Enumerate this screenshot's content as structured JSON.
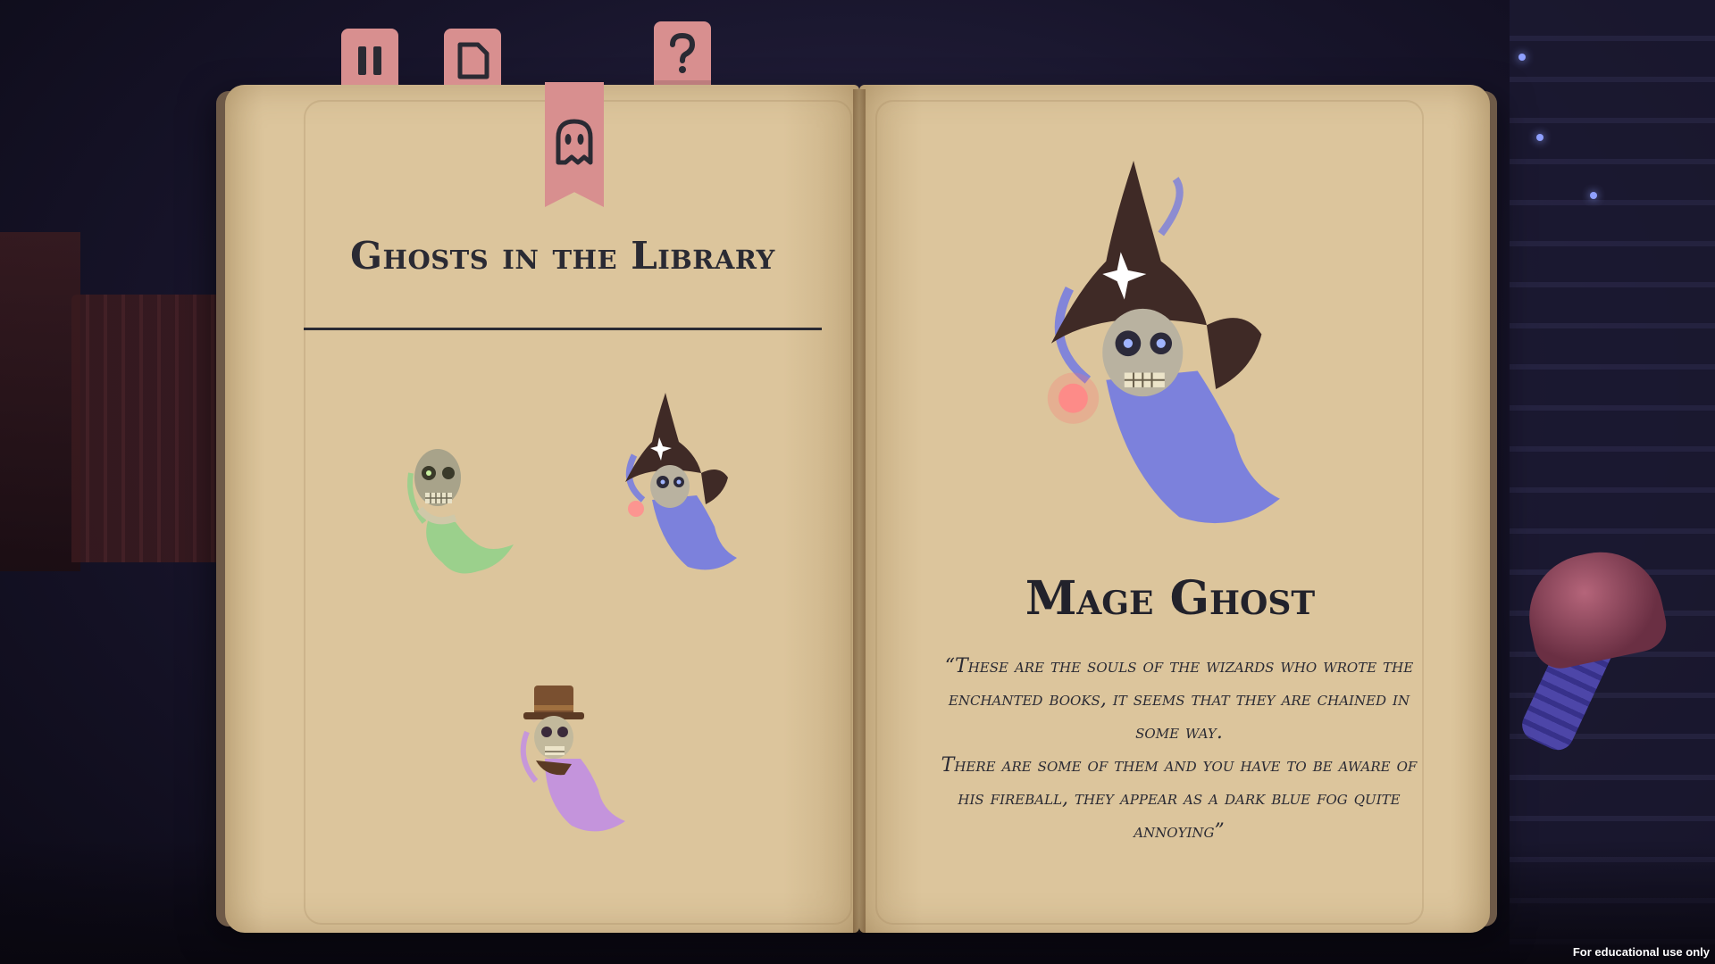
{
  "toolbar": {
    "pause_icon": "pause-icon",
    "page_icon": "document-icon",
    "help_icon": "question-icon",
    "active_tab_icon": "ghost-icon"
  },
  "left_page": {
    "title": "Ghosts in the Library",
    "ghosts": [
      {
        "name": "skeleton ghost",
        "color": "#8fd18a"
      },
      {
        "name": "mage ghost",
        "color": "#6b74e8"
      },
      {
        "name": "top hat ghost",
        "color": "#c08be8"
      }
    ]
  },
  "right_page": {
    "name": "Mage Ghost",
    "description_lines": [
      "“These are the souls of the wizards who wrote the enchanted books, it seems that they are chained in some way.",
      "There are some of them and you have to be aware of his fireball, they appear as a dark blue fog quite annoying”"
    ]
  },
  "colors": {
    "page": "#dcc59c",
    "tab": "#d88f8f",
    "ink": "#2a2a33"
  },
  "footer": {
    "watermark": "For educational use only"
  }
}
